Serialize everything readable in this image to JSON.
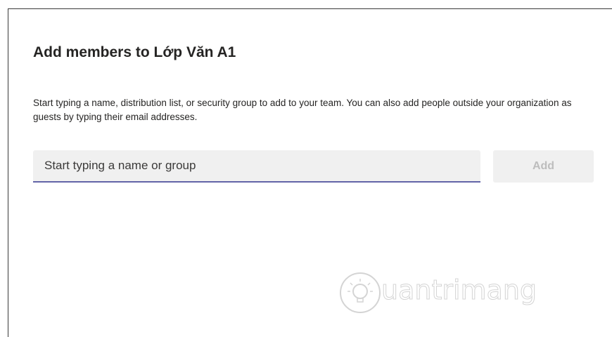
{
  "dialog": {
    "title": "Add members to Lớp Văn A1",
    "description": "Start typing a name, distribution list, or security group to add to your team. You can also add people outside your organization as guests by typing their email addresses."
  },
  "search": {
    "placeholder": "Start typing a name or group",
    "value": ""
  },
  "add_button": {
    "label": "Add"
  },
  "watermark": {
    "text": "uantrimang",
    "icon": "lightbulb-icon"
  },
  "colors": {
    "accent": "#6264a7",
    "field_bg": "#f0f0f0",
    "disabled_text": "#bdbdbd",
    "text": "#252423"
  }
}
